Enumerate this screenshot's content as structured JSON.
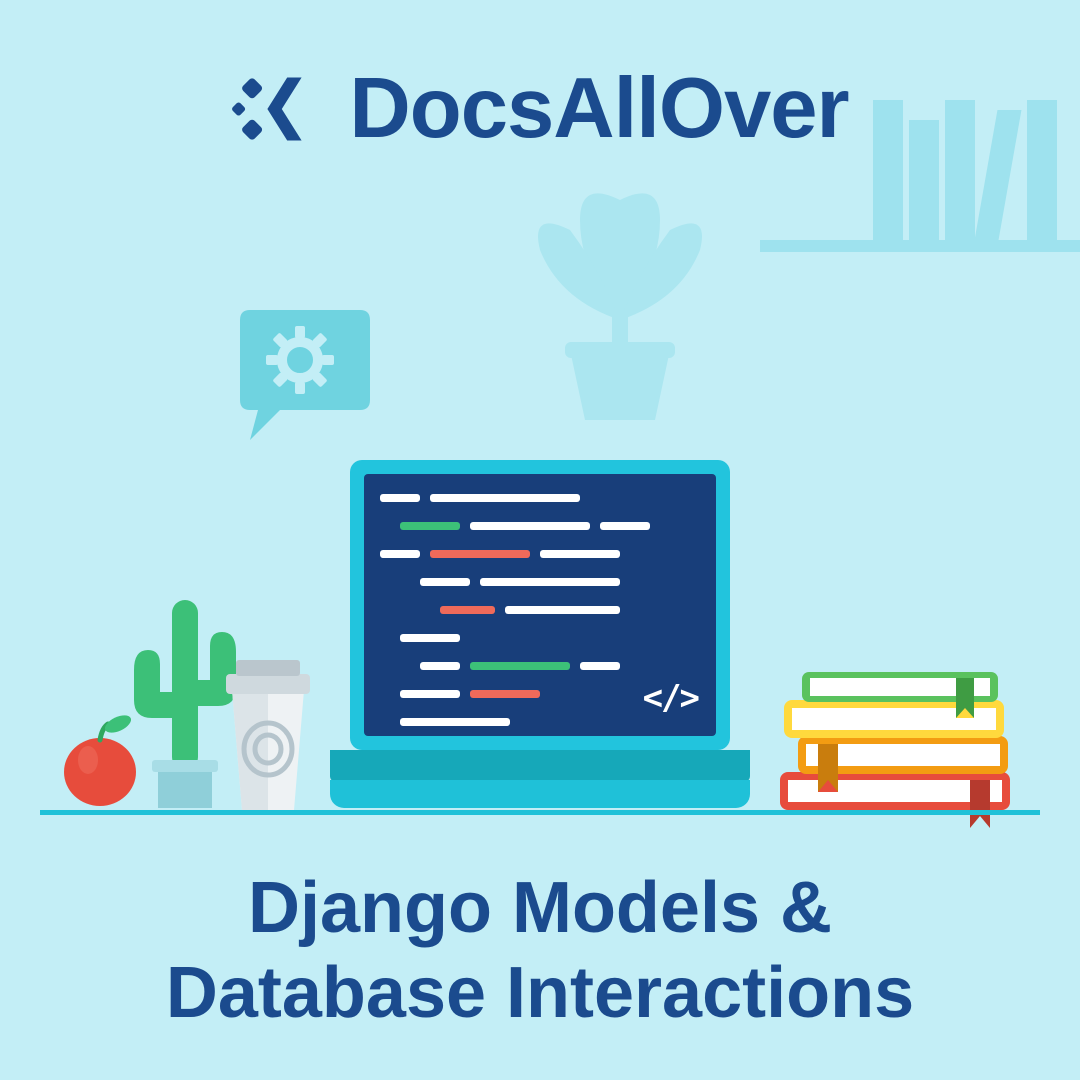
{
  "brand": "DocsAllOver",
  "title_line1": "Django Models &",
  "title_line2": "Database Interactions",
  "code_symbol": "</>",
  "colors": {
    "background": "#c3eef6",
    "primary_text": "#1b4b8e",
    "accent_teal": "#22c4dd",
    "screen_bg": "#183e7a",
    "code_white": "#ffffff",
    "code_green": "#3cc078",
    "code_red": "#ef6a5a"
  }
}
